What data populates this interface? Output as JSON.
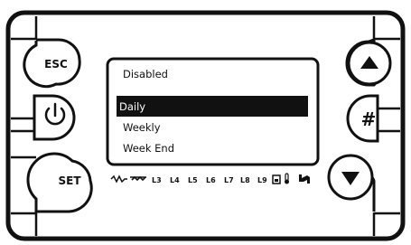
{
  "device": {
    "keys": {
      "esc": "ESC",
      "power": "power-icon",
      "set": "SET",
      "up": "up-arrow-icon",
      "hash": "#",
      "down": "down-arrow-icon"
    },
    "menu": {
      "title": "Disabled",
      "items": [
        "Daily",
        "Weekly",
        "Week End"
      ],
      "selected_index": 0
    },
    "status_bar": {
      "loads": [
        "L3",
        "L4",
        "L5",
        "L6",
        "L7",
        "L8",
        "L9"
      ],
      "icons": [
        "heater-icon",
        "defrost-icon",
        "bin-icon",
        "thermometer-icon",
        "pump-icon"
      ]
    },
    "colors": {
      "outline": "#111111",
      "lcd_background": "#ffffff",
      "highlight": "#111111",
      "highlight_text": "#ffffff"
    }
  }
}
